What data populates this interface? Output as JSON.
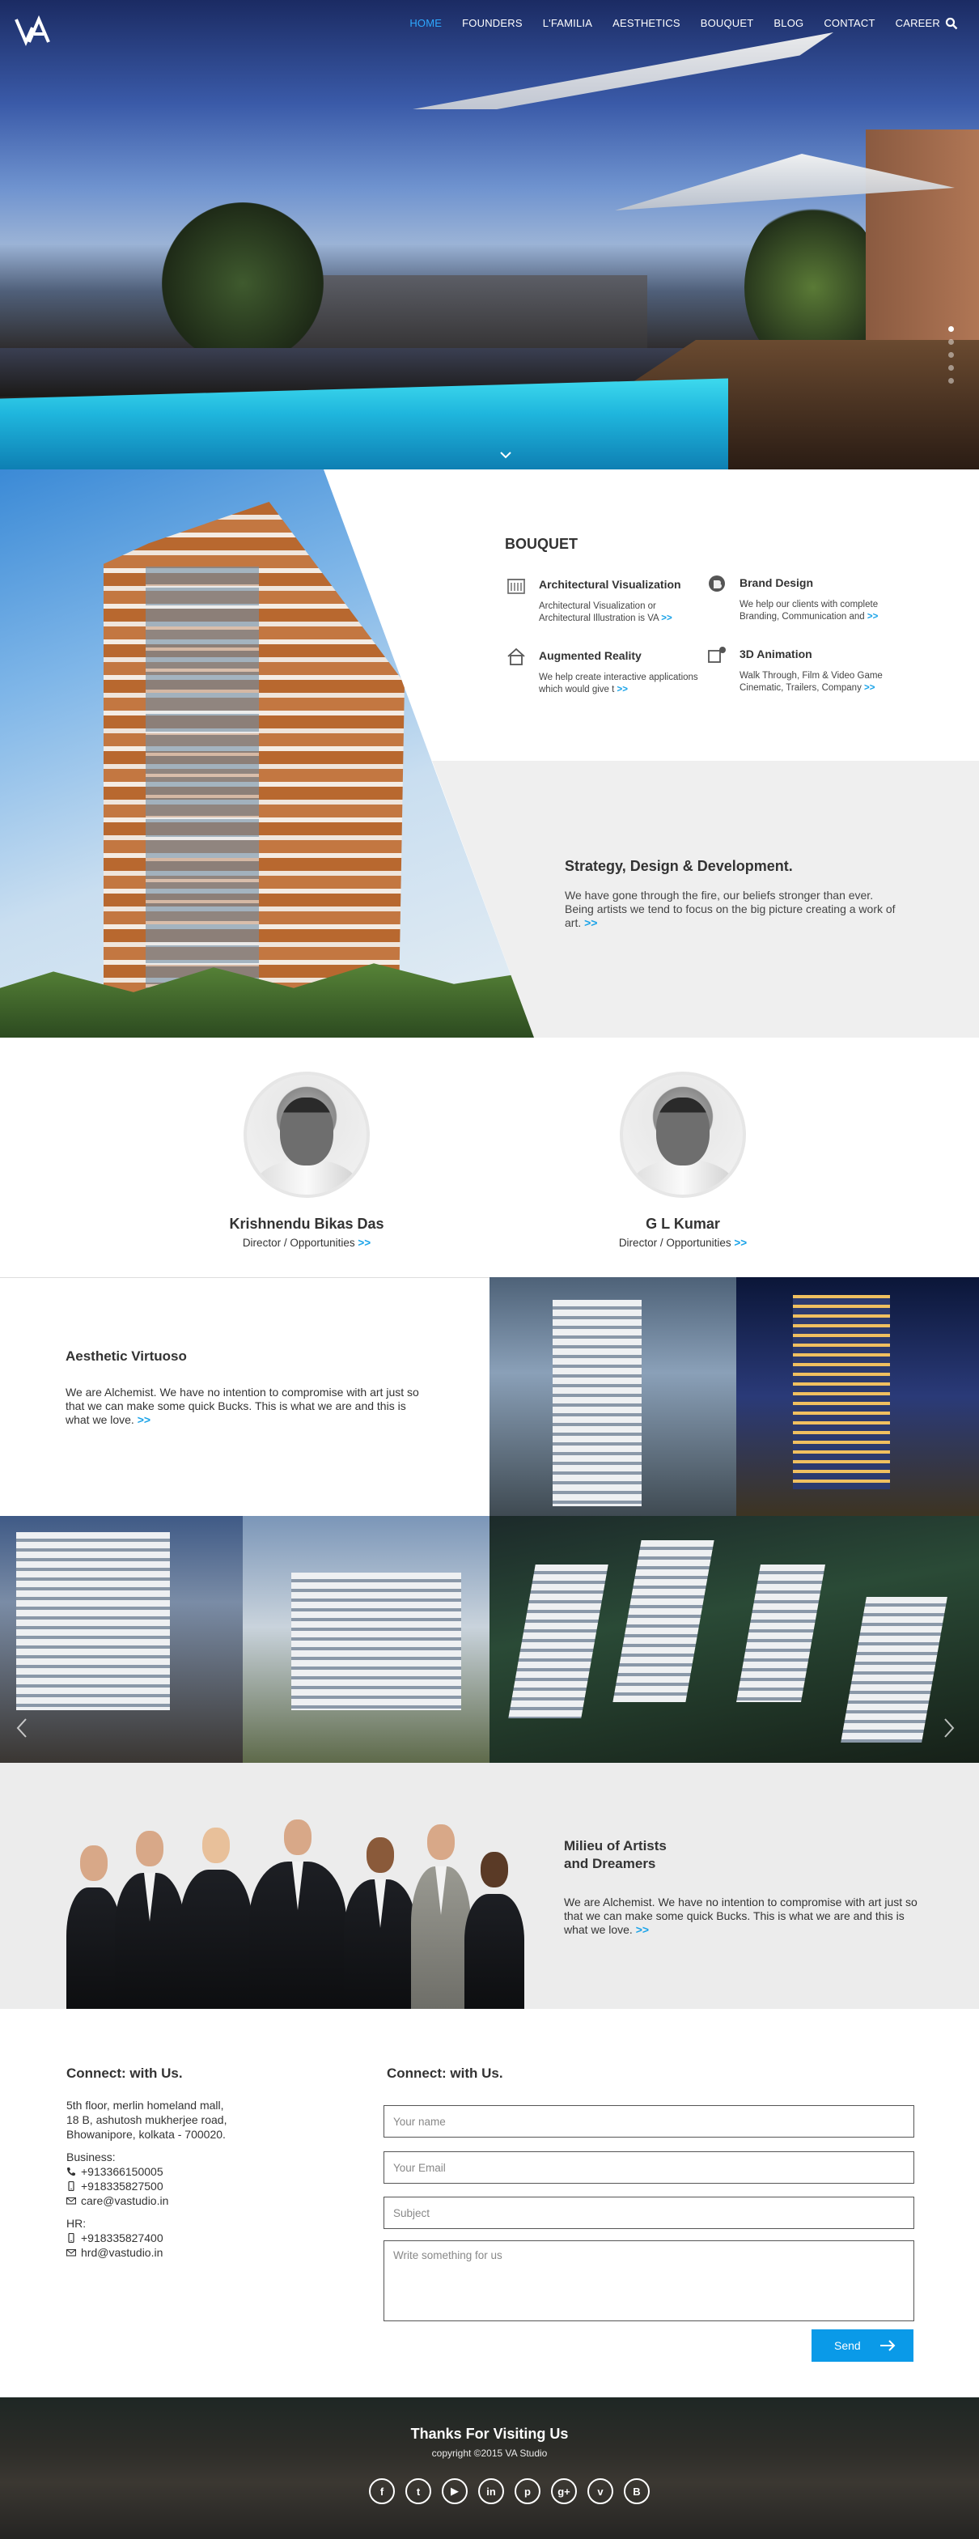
{
  "nav": {
    "items": [
      "HOME",
      "FOUNDERS",
      "L'FAMILIA",
      "AESTHETICS",
      "BOUQUET",
      "BLOG",
      "CONTACT",
      "CAREER"
    ],
    "active_index": 0
  },
  "hero": {
    "slides": 5,
    "active_slide": 0
  },
  "bouquet": {
    "title": "BOUQUET",
    "services": [
      {
        "title": "Architectural Visualization",
        "text": "Architectural Visualization or Architectural Illustration is VA",
        "more": ">>",
        "icon": "building-icon"
      },
      {
        "title": "Brand Design",
        "text": "We help our clients with complete Branding, Communication and",
        "more": ">>",
        "icon": "brand-icon"
      },
      {
        "title": "Augmented Reality",
        "text": "We help create interactive applications which would give t",
        "more": ">>",
        "icon": "home-icon"
      },
      {
        "title": "3D Animation",
        "text": "Walk Through, Film & Video Game Cinematic, Trailers, Company",
        "more": ">>",
        "icon": "cube-icon"
      }
    ],
    "strategy": {
      "title": "Strategy, Design & Development.",
      "text": "We have gone through the fire, our beliefs stronger than ever. Being artists we tend to focus on the big picture creating a work of art.",
      "more": ">>"
    }
  },
  "founders": [
    {
      "name": "Krishnendu Bikas Das",
      "role": "Director / Opportunities",
      "more": ">>"
    },
    {
      "name": "G L Kumar",
      "role": "Director / Opportunities",
      "more": ">>"
    }
  ],
  "aesthetics": {
    "title": "Aesthetic Virtuoso",
    "text": "We are Alchemist. We have no intention to compromise with art just so that we can make some quick Bucks. This is what we are and this is what we love.",
    "more": ">>"
  },
  "milieu": {
    "title": "Milieu of Artists and Dreamers",
    "text": "We are Alchemist. We have no intention to compromise with art just so that we can make some quick Bucks. This is what we are and this is what we love.",
    "more": ">>"
  },
  "contact": {
    "left_title": "Connect: with Us.",
    "right_title": "Connect: with Us.",
    "address": [
      "5th floor, merlin homeland mall,",
      "18 B, ashutosh mukherjee road,",
      "Bhowanipore, kolkata - 700020."
    ],
    "business_label": "Business:",
    "business_phone": "+913366150005",
    "business_mobile": "+918335827500",
    "business_email": "care@vastudio.in",
    "hr_label": "HR:",
    "hr_mobile": "+918335827400",
    "hr_email": "hrd@vastudio.in",
    "form": {
      "name_placeholder": "Your name",
      "email_placeholder": "Your Email",
      "subject_placeholder": "Subject",
      "message_placeholder": "Write something for us",
      "send_label": "Send"
    }
  },
  "footer": {
    "title": "Thanks For Visiting Us",
    "copyright": "copyright ©2015 VA Studio",
    "socials": [
      "facebook-icon",
      "twitter-icon",
      "youtube-icon",
      "linkedin-icon",
      "pinterest-icon",
      "googleplus-icon",
      "vimeo-icon",
      "blogger-icon"
    ]
  },
  "colors": {
    "accent": "#1aa3e8",
    "send_button": "#0a9ae8",
    "section_grey": "#efefef"
  }
}
